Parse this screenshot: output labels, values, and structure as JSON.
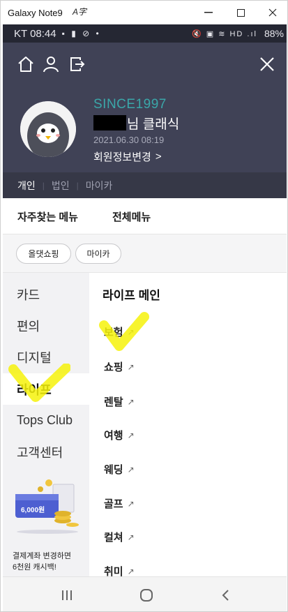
{
  "window": {
    "title": "Galaxy Note9",
    "translate_icon": "A字",
    "controls": {
      "minimize": "—",
      "maximize": "☐",
      "close": "✕"
    }
  },
  "status_bar": {
    "time": "KT 08:44",
    "left_icons": "▪ ▮ ⊘ •",
    "right_icons": "🔇 ▣ ≋ HD .ıl",
    "battery": "88%"
  },
  "header": {
    "icons": [
      "home-icon",
      "user-icon",
      "logout-icon",
      "close-icon"
    ],
    "since": "SINCE1997",
    "name_suffix": "님 클래식",
    "joined": "2021.06.30 08:19",
    "edit_info": "회원정보변경",
    "edit_chevron": ">",
    "member_tabs": [
      "개인",
      "법인",
      "마이카"
    ],
    "member_sep": "|",
    "active_member_tab": "개인"
  },
  "menu_tabs": {
    "favorites": "자주찾는 메뉴",
    "all": "전체메뉴",
    "active": "전체메뉴"
  },
  "chips": [
    "올댓쇼핑",
    "마이카"
  ],
  "sidebar": {
    "categories": [
      "카드",
      "편의",
      "디지털",
      "라이프",
      "Tops Club",
      "고객센터"
    ],
    "active": "라이프",
    "promo_badge": "6,000원",
    "promo_text_line1": "결제계좌 변경하면",
    "promo_text_line2": "6천원 캐시백!"
  },
  "pane": {
    "title": "라이프 메인",
    "arrow": "↗",
    "items": [
      "보험",
      "쇼핑",
      "렌탈",
      "여행",
      "웨딩",
      "골프",
      "컬쳐",
      "취미"
    ]
  },
  "colors": {
    "header_bg": "#404256",
    "since_text": "#3aa7a9",
    "highlighter": "#f6f20a"
  },
  "nav_icons": [
    "recent-apps-icon",
    "home-circle-icon",
    "back-chevron-icon"
  ]
}
